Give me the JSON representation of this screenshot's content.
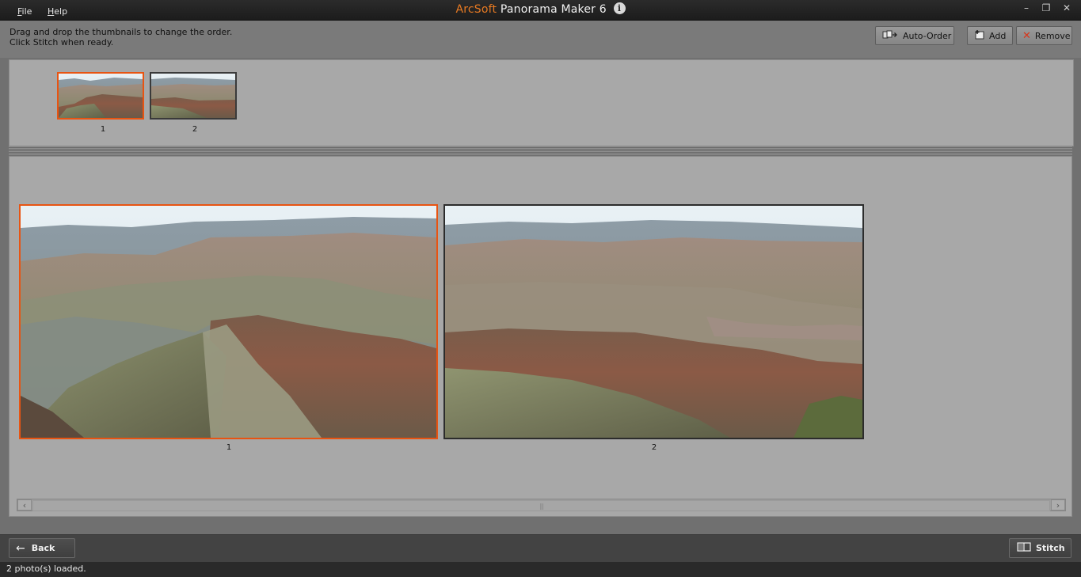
{
  "menu": {
    "file": "File",
    "help": "Help"
  },
  "app": {
    "brand": "ArcSoft",
    "name": "Panorama Maker 6"
  },
  "instructions": {
    "line1": "Drag and drop the thumbnails to change the order.",
    "line2": "Click Stitch when ready."
  },
  "toolbar": {
    "auto_order": "Auto-Order",
    "add": "Add",
    "remove": "Remove"
  },
  "thumbnails": [
    {
      "label": "1",
      "selected": true
    },
    {
      "label": "2",
      "selected": false
    }
  ],
  "photos": [
    {
      "label": "1",
      "selected": true
    },
    {
      "label": "2",
      "selected": false
    }
  ],
  "footer": {
    "back": "Back",
    "stitch": "Stitch"
  },
  "status": {
    "text": "2 photo(s) loaded."
  },
  "colors": {
    "accent": "#e87a22",
    "selection": "#e85412"
  }
}
